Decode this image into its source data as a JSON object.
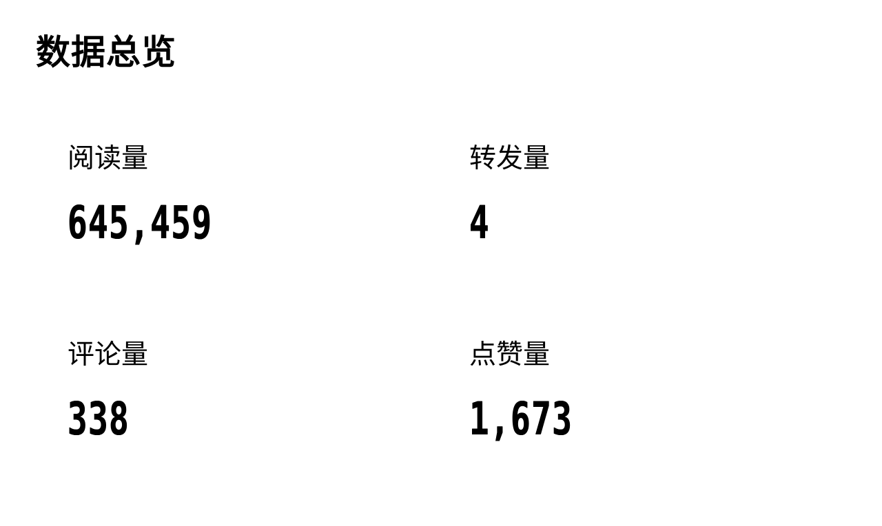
{
  "header": {
    "title": "数据总览"
  },
  "metrics": [
    {
      "label": "阅读量",
      "value": "645,459"
    },
    {
      "label": "转发量",
      "value": "4"
    },
    {
      "label": "评论量",
      "value": "338"
    },
    {
      "label": "点赞量",
      "value": "1,673"
    }
  ],
  "colors": {
    "text": "#000000",
    "background": "#ffffff"
  }
}
